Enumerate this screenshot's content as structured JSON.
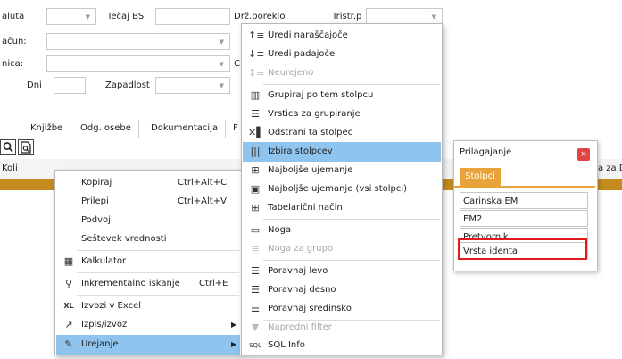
{
  "form": {
    "valuta_label": "aluta",
    "tecaj_label": "Tečaj BS",
    "drz_label": "Drž.poreklo",
    "tristr_label": "Tristr.p",
    "racun_label": "ačun:",
    "nica_label": "nica:",
    "c_label": "C",
    "dni_label": "Dni",
    "zapadlost_label": "Zapadlost"
  },
  "tabs": [
    "Knjižbe",
    "Odg. osebe",
    "Dokumentacija",
    "F"
  ],
  "grid": {
    "col_koli": "Koli",
    "col_right": "a za D"
  },
  "context_menu": [
    {
      "icon": "",
      "label": "Kopiraj",
      "shortcut": "Ctrl+Alt+C"
    },
    {
      "icon": "",
      "label": "Prilepi",
      "shortcut": "Ctrl+Alt+V"
    },
    {
      "icon": "",
      "label": "Podvoji",
      "shortcut": ""
    },
    {
      "icon": "",
      "label": "Seštevek vrednosti",
      "shortcut": ""
    },
    {
      "icon": "calculator-icon",
      "label": "Kalkulator",
      "shortcut": ""
    },
    {
      "icon": "search-icon",
      "label": "Inkrementalno iskanje",
      "shortcut": "Ctrl+E"
    },
    {
      "icon": "excel-export-icon",
      "label": "Izvozi v Excel",
      "shortcut": ""
    },
    {
      "icon": "print-export-icon",
      "label": "Izpis/izvoz",
      "shortcut": ""
    },
    {
      "icon": "pencil-icon",
      "label": "Urejanje",
      "shortcut": ""
    }
  ],
  "submenu": [
    {
      "icon": "sort-ascending-icon",
      "label": "Uredi naraščajoče"
    },
    {
      "icon": "sort-descending-icon",
      "label": "Uredi padajoče"
    },
    {
      "icon": "unsorted-icon",
      "label": "Neurejeno"
    },
    {
      "icon": "group-column-icon",
      "label": "Grupiraj po tem stolpcu"
    },
    {
      "icon": "group-row-icon",
      "label": "Vrstica za grupiranje"
    },
    {
      "icon": "remove-column-icon",
      "label": "Odstrani ta stolpec"
    },
    {
      "icon": "choose-columns-icon",
      "label": "Izbira stolpcev"
    },
    {
      "icon": "best-fit-icon",
      "label": "Najboljše ujemanje"
    },
    {
      "icon": "best-fit-all-icon",
      "label": "Najboljše ujemanje (vsi stolpci)"
    },
    {
      "icon": "table-mode-icon",
      "label": "Tabelarični način"
    },
    {
      "icon": "footer-icon",
      "label": "Noga"
    },
    {
      "icon": "group-footer-icon",
      "label": "Noga za grupo"
    },
    {
      "icon": "align-left-icon",
      "label": "Poravnaj levo"
    },
    {
      "icon": "align-right-icon",
      "label": "Poravnaj desno"
    },
    {
      "icon": "align-center-icon",
      "label": "Poravnaj sredinsko"
    },
    {
      "icon": "advanced-filter-icon",
      "label": "Napredni filter"
    },
    {
      "icon": "sql-info-icon",
      "label": "SQL Info"
    }
  ],
  "panel": {
    "title": "Prilagajanje",
    "close": "×",
    "tab": "Stolpci",
    "items": [
      "Carinska EM",
      "EM2",
      "Pretvornik",
      "Vrsta identa"
    ]
  },
  "colors": {
    "highlight": "#8fc4ee",
    "accent": "#e8a33a",
    "grid_bar": "#c58a20",
    "outline": "#e01b1b"
  }
}
